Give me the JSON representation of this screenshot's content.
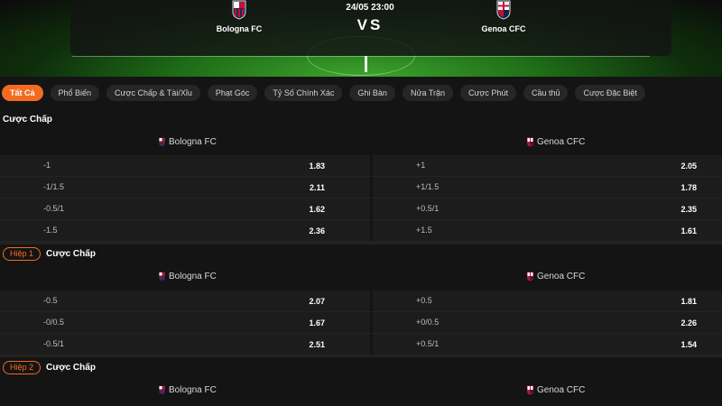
{
  "match": {
    "home_team": "Bologna FC",
    "away_team": "Genoa CFC",
    "datetime": "24/05 23:00",
    "vs": "VS"
  },
  "tabs": [
    {
      "label": "Tất Cả",
      "active": true
    },
    {
      "label": "Phổ Biến"
    },
    {
      "label": "Cược Chấp & Tài/Xỉu"
    },
    {
      "label": "Phạt Góc"
    },
    {
      "label": "Tỷ Số Chính Xác"
    },
    {
      "label": "Ghi Bàn"
    },
    {
      "label": "Nửa Trận"
    },
    {
      "label": "Cược Phút"
    },
    {
      "label": "Cầu thủ"
    },
    {
      "label": "Cược Đặc Biệt"
    }
  ],
  "sections": [
    {
      "title": "Cược Chấp",
      "badge": "",
      "home": "Bologna FC",
      "away": "Genoa CFC",
      "rows": [
        {
          "home_line": "-1",
          "home_odd": "1.83",
          "away_line": "+1",
          "away_odd": "2.05"
        },
        {
          "home_line": "-1/1.5",
          "home_odd": "2.11",
          "away_line": "+1/1.5",
          "away_odd": "1.78"
        },
        {
          "home_line": "-0.5/1",
          "home_odd": "1.62",
          "away_line": "+0.5/1",
          "away_odd": "2.35"
        },
        {
          "home_line": "-1.5",
          "home_odd": "2.36",
          "away_line": "+1.5",
          "away_odd": "1.61"
        }
      ]
    },
    {
      "title": "Cược Chấp",
      "badge": "Hiệp 1",
      "home": "Bologna FC",
      "away": "Genoa CFC",
      "rows": [
        {
          "home_line": "-0.5",
          "home_odd": "2.07",
          "away_line": "+0.5",
          "away_odd": "1.81"
        },
        {
          "home_line": "-0/0.5",
          "home_odd": "1.67",
          "away_line": "+0/0.5",
          "away_odd": "2.26"
        },
        {
          "home_line": "-0.5/1",
          "home_odd": "2.51",
          "away_line": "+0.5/1",
          "away_odd": "1.54"
        }
      ]
    },
    {
      "title": "Cược Chấp",
      "badge": "Hiệp 2",
      "home": "Bologna FC",
      "away": "Genoa CFC",
      "rows": []
    }
  ],
  "colors": {
    "accent": "#f36b21",
    "background": "#141414",
    "cell": "#1c1c1c",
    "bologna_red": "#c8102e",
    "bologna_blue": "#1b2a5c",
    "genoa_red": "#c8102e",
    "genoa_blue": "#12224a"
  }
}
